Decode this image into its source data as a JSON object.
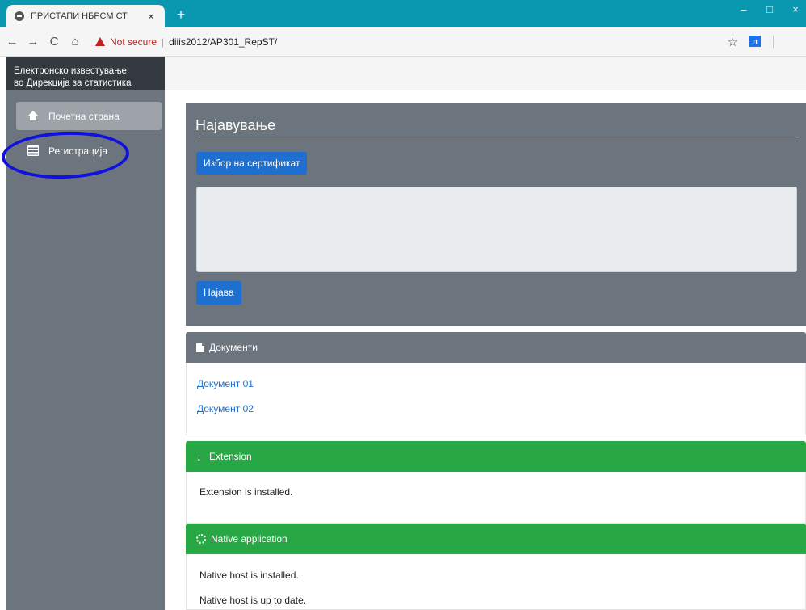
{
  "browser": {
    "tab_title": "ПРИСТАПИ НБРСМ СТ",
    "tab_close": "×",
    "new_tab": "+",
    "window_controls": {
      "minimize": "–",
      "maximize": "□",
      "close": "×"
    },
    "nav": {
      "back": "←",
      "forward": "→",
      "reload": "C",
      "home": "⌂"
    },
    "security_warning": "Not secure",
    "url_separator": "|",
    "url": "diiis2012/AP301_RepST/",
    "bookmark_star": "☆",
    "extension_badge": "n"
  },
  "sidebar": {
    "header_line1": "Електронско известување",
    "header_line2": "во Дирекција за статистика",
    "items": [
      {
        "label": "Почетна страна",
        "icon": "home-icon",
        "active": true
      },
      {
        "label": "Регистрација",
        "icon": "list-icon",
        "active": false
      }
    ],
    "annotation_color": "#1010e0"
  },
  "login": {
    "title": "Најавување",
    "cert_button": "Избор на сертификат",
    "cert_textarea_value": "",
    "login_button": "Најава"
  },
  "documents": {
    "header": "Документи",
    "links": [
      "Документ 01",
      "Документ 02"
    ]
  },
  "extension": {
    "header": "Extension",
    "status": "Extension is installed."
  },
  "native": {
    "header": "Native application",
    "status_installed": "Native host is installed.",
    "status_uptodate": "Native host is up to date."
  },
  "colors": {
    "chrome_tabbar": "#0a97b0",
    "sidebar_bg": "#6c757d",
    "sidebar_header_bg": "#343a40",
    "primary_button": "#1e6fd0",
    "success_header": "#28a745",
    "warning_red": "#c5221f"
  }
}
